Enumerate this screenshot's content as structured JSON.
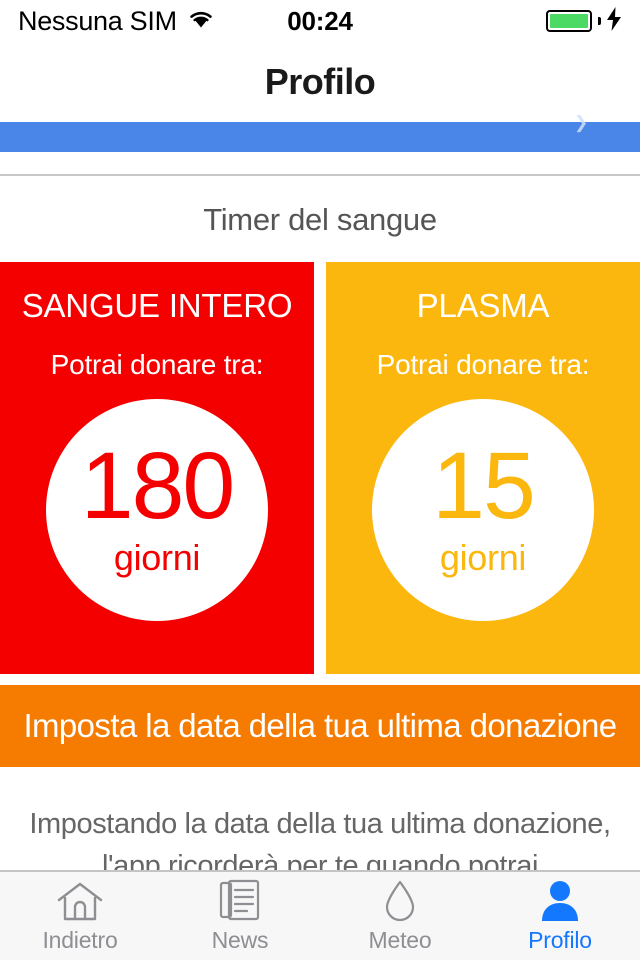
{
  "status_bar": {
    "carrier": "Nessuna SIM",
    "wifi_icon": "wifi-icon",
    "time": "00:24",
    "battery_icon": "battery-full-icon",
    "charging_icon": "lightning-bolt-icon",
    "battery_color": "#4CD964"
  },
  "nav": {
    "title": "Profilo"
  },
  "partial_row": {
    "accent_color": "#4a86e8",
    "chevron_icon": "chevron-right-icon"
  },
  "section": {
    "title": "Timer del sangue"
  },
  "cards": [
    {
      "name": "whole-blood",
      "title": "SANGUE INTERO",
      "subtitle": "Potrai donare tra:",
      "value": "180",
      "unit": "giorni",
      "color": "#F40000"
    },
    {
      "name": "plasma",
      "title": "PLASMA",
      "subtitle": "Potrai donare tra:",
      "value": "15",
      "unit": "giorni",
      "color": "#FBB70D"
    }
  ],
  "action": {
    "label": "Imposta la data della tua ultima donazione",
    "color": "#F57C00"
  },
  "footnote": {
    "line1": "Impostando la data della tua ultima donazione,",
    "line2": "l'app ricorderà per te quando potrai"
  },
  "tabbar": {
    "items": [
      {
        "label": "Indietro",
        "icon": "home-icon",
        "active": false
      },
      {
        "label": "News",
        "icon": "newspaper-icon",
        "active": false
      },
      {
        "label": "Meteo",
        "icon": "water-drop-icon",
        "active": false
      },
      {
        "label": "Profilo",
        "icon": "person-icon",
        "active": true
      }
    ],
    "active_color": "#1478ff",
    "inactive_color": "#8e8e93"
  }
}
